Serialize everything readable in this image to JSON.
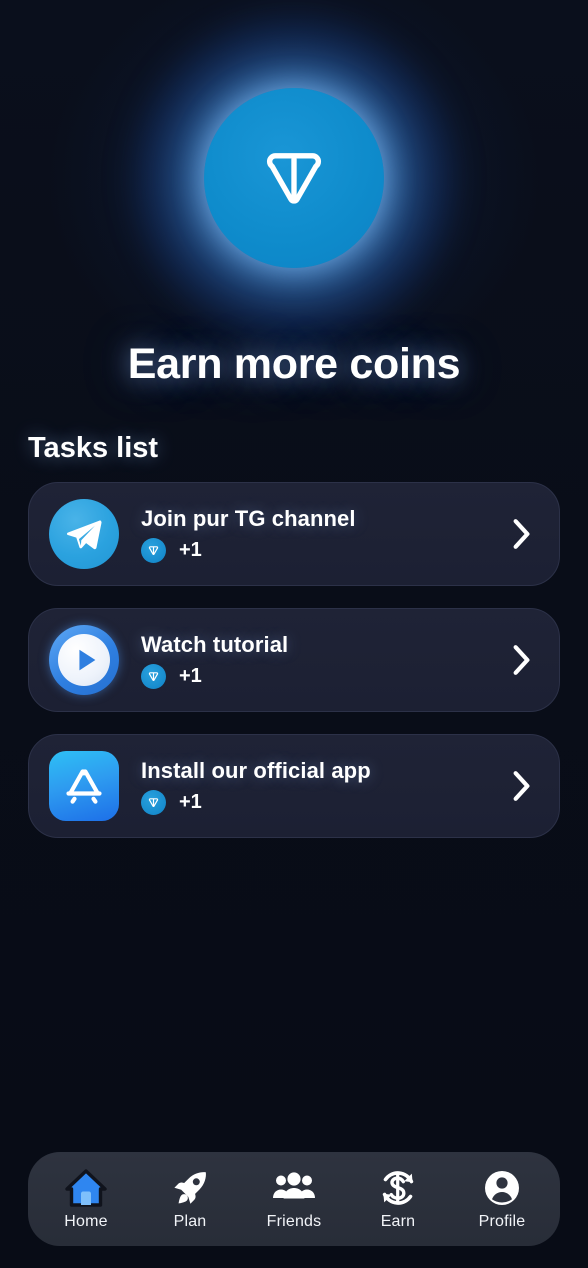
{
  "hero": {
    "logo_icon": "ton-coin-icon",
    "title": "Earn more coins"
  },
  "tasks_section": {
    "heading": "Tasks list",
    "items": [
      {
        "icon": "telegram-icon",
        "title": "Join pur TG channel",
        "reward_icon": "ton-coin-icon",
        "reward": "+1",
        "chevron": "chevron-right-icon"
      },
      {
        "icon": "play-circle-icon",
        "title": "Watch tutorial",
        "reward_icon": "ton-coin-icon",
        "reward": "+1",
        "chevron": "chevron-right-icon"
      },
      {
        "icon": "app-store-icon",
        "title": "Install our official app",
        "reward_icon": "ton-coin-icon",
        "reward": "+1",
        "chevron": "chevron-right-icon"
      }
    ]
  },
  "bottom_nav": {
    "items": [
      {
        "label": "Home",
        "icon": "home-icon",
        "active": true
      },
      {
        "label": "Plan",
        "icon": "rocket-icon",
        "active": false
      },
      {
        "label": "Friends",
        "icon": "people-icon",
        "active": false
      },
      {
        "label": "Earn",
        "icon": "currency-refresh-icon",
        "active": false
      },
      {
        "label": "Profile",
        "icon": "person-circle-icon",
        "active": false
      }
    ]
  },
  "colors": {
    "background": "#090d18",
    "card_background": "#1f2336",
    "card_border": "#2c3148",
    "accent_blue": "#0f8ccc",
    "nav_background": "#2e333f",
    "nav_active": "#2f86f0",
    "text_primary": "#ffffff"
  }
}
